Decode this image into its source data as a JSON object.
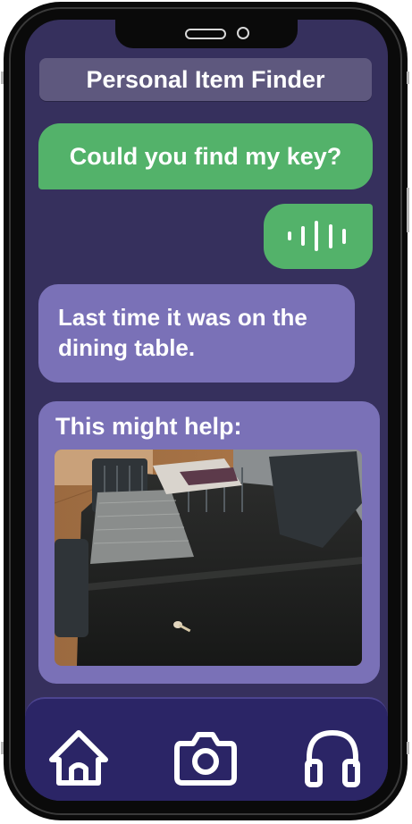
{
  "app": {
    "title": "Personal Item Finder"
  },
  "chat": {
    "user_message": "Could you find my key?",
    "voice_message_icon": "audio-wave-icon",
    "assistant_message": "Last time it was on the dining table.",
    "help_text": "This might help:"
  },
  "photo": {
    "subject": "key on dining table"
  },
  "navbar": {
    "items": [
      {
        "icon": "home-icon"
      },
      {
        "icon": "camera-icon"
      },
      {
        "icon": "headphones-icon"
      }
    ]
  },
  "colors": {
    "background": "#36305d",
    "user_bubble": "#53b26a",
    "assistant_bubble": "#7a71b7",
    "title_bar": "#5e587e",
    "navbar": "#2b2566"
  }
}
